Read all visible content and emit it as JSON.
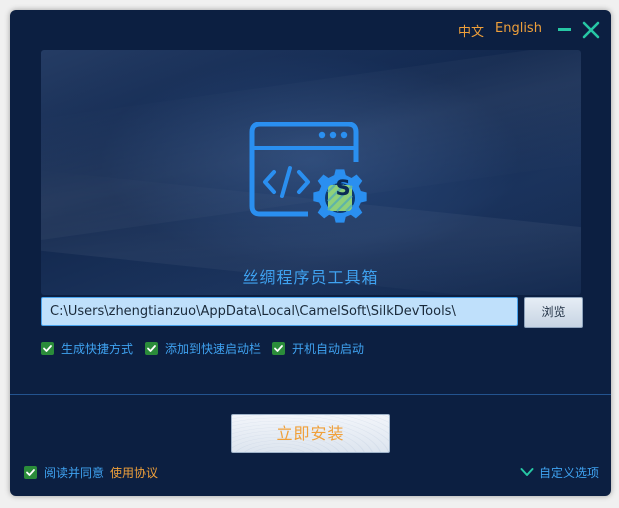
{
  "titlebar": {
    "lang_zh": "中文",
    "lang_en": "English",
    "minimize_icon": "minimize-icon",
    "close_icon": "close-icon"
  },
  "hero": {
    "logo_icon": "code-window-gear-icon",
    "logo_letter": "S",
    "product_name": "丝绸程序员工具箱"
  },
  "install_path": {
    "value": "C:\\Users\\zhengtianzuo\\AppData\\Local\\CamelSoft\\SilkDevTools\\",
    "browse_label": "浏览"
  },
  "options": [
    {
      "label": "生成快捷方式",
      "checked": true
    },
    {
      "label": "添加到快速启动栏",
      "checked": true
    },
    {
      "label": "开机自动启动",
      "checked": true
    }
  ],
  "install_button": "立即安装",
  "agreement": {
    "checked": true,
    "text": "阅读并同意",
    "link": "使用协议"
  },
  "custom_options": {
    "label": "自定义选项",
    "icon": "chevron-down-icon"
  },
  "colors": {
    "background": "#0c1f41",
    "accent_blue": "#3fa2f0",
    "accent_orange": "#f0a03a",
    "accent_teal": "#27c7a4",
    "check_green": "#2b8c3a"
  }
}
